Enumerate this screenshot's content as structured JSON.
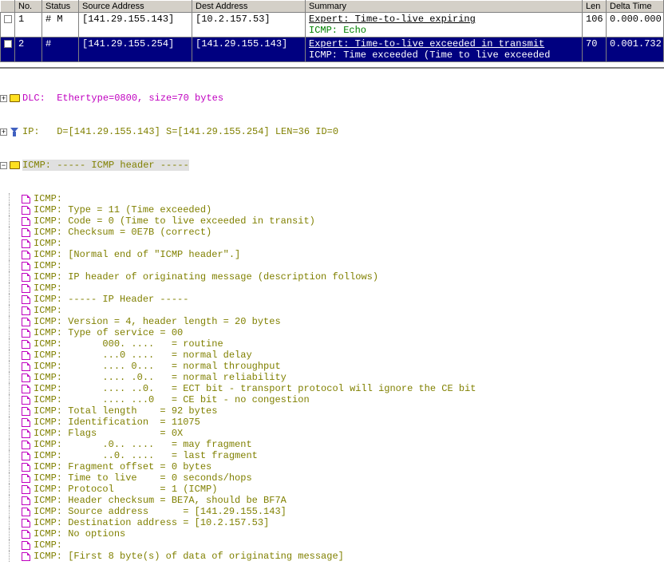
{
  "table": {
    "headers": [
      "",
      "No.",
      "Status",
      "Source Address",
      "Dest Address",
      "Summary",
      "Len",
      "Delta Time"
    ],
    "rows": [
      {
        "no": "1",
        "status": "# M",
        "src": "[141.29.155.143]",
        "dst": "[10.2.157.53]",
        "summary_expert": "Expert: Time-to-live expiring",
        "summary_proto": "ICMP: Echo",
        "len": "106",
        "dt": "0.000.000",
        "selected": false
      },
      {
        "no": "2",
        "status": "#",
        "src": "[141.29.155.254]",
        "dst": "[141.29.155.143]",
        "summary_expert": "Expert: Time-to-live exceeded in transmit",
        "summary_proto": "ICMP: Time exceeded (Time to live exceeded",
        "len": "70",
        "dt": "0.001.732",
        "selected": true
      }
    ]
  },
  "decode": {
    "dlc": "DLC:  Ethertype=0800, size=70 bytes",
    "ip": "IP:   D=[141.29.155.143] S=[141.29.155.254] LEN=36 ID=0",
    "icmp_hdr": "ICMP: ----- ICMP header -----",
    "lines": [
      "ICMP:",
      "ICMP: Type = 11 (Time exceeded)",
      "ICMP: Code = 0 (Time to live exceeded in transit)",
      "ICMP: Checksum = 0E7B (correct)",
      "ICMP:",
      "ICMP: [Normal end of \"ICMP header\".]",
      "ICMP:",
      "ICMP: IP header of originating message (description follows)",
      "ICMP:",
      "ICMP: ----- IP Header -----",
      "ICMP:",
      "ICMP: Version = 4, header length = 20 bytes",
      "ICMP: Type of service = 00",
      "ICMP:       000. ....   = routine",
      "ICMP:       ...0 ....   = normal delay",
      "ICMP:       .... 0...   = normal throughput",
      "ICMP:       .... .0..   = normal reliability",
      "ICMP:       .... ..0.   = ECT bit - transport protocol will ignore the CE bit",
      "ICMP:       .... ...0   = CE bit - no congestion",
      "ICMP: Total length    = 92 bytes",
      "ICMP: Identification  = 11075",
      "ICMP: Flags           = 0X",
      "ICMP:       .0.. ....   = may fragment",
      "ICMP:       ..0. ....   = last fragment",
      "ICMP: Fragment offset = 0 bytes",
      "ICMP: Time to live    = 0 seconds/hops",
      "ICMP: Protocol        = 1 (ICMP)",
      "ICMP: Header checksum = BE7A, should be BF7A",
      "ICMP: Source address      = [141.29.155.143]",
      "ICMP: Destination address = [10.2.157.53]",
      "ICMP: No options",
      "ICMP:",
      "ICMP: [First 8 byte(s) of data of originating message]"
    ]
  }
}
